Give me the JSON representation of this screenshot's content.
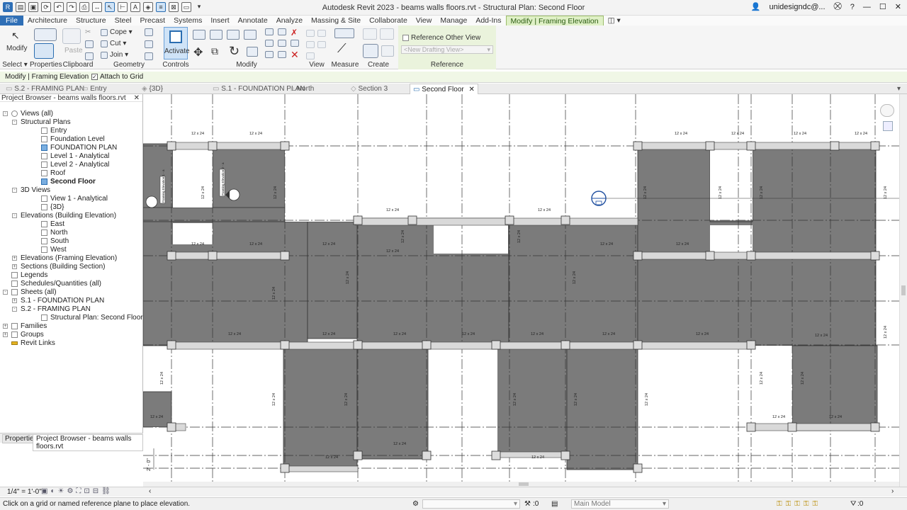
{
  "app": {
    "title": "Autodesk Revit 2023 - beams walls floors.rvt - Structural Plan: Second Floor",
    "user": "unidesigndc@..."
  },
  "menu": [
    "File",
    "Architecture",
    "Structure",
    "Steel",
    "Precast",
    "Systems",
    "Insert",
    "Annotate",
    "Analyze",
    "Massing & Site",
    "Collaborate",
    "View",
    "Manage",
    "Add-Ins",
    "Modify | Framing Elevation"
  ],
  "ribbon": {
    "modify_label": "Modify",
    "select_label": "Select ▾",
    "properties_label": "Properties",
    "paste_label": "Paste",
    "cope_label": "Cope ▾",
    "cut_label": "Cut ▾",
    "join_label": "Join ▾",
    "clipboard_label": "Clipboard",
    "geometry_label": "Geometry",
    "activate_label": "Activate",
    "controls_label": "Controls",
    "modify_panel_label": "Modify",
    "view_label": "View",
    "measure_label": "Measure",
    "create_label": "Create",
    "reference_label": "Reference",
    "reference_other_view": "Reference Other View",
    "drafting_view_placeholder": "<New Drafting View>"
  },
  "options_bar": {
    "context": "Modify | Framing Elevation",
    "attach_to_grid": "Attach to Grid"
  },
  "tabs": [
    "S.2 - FRAMING PLAN",
    "Entry",
    "{3D}",
    "S.1 - FOUNDATION PLAN",
    "North",
    "Section 3",
    "Second Floor"
  ],
  "browser": {
    "title": "Project Browser - beams walls floors.rvt",
    "nodes": [
      {
        "label": "Views (all)"
      },
      {
        "label": "Structural Plans"
      },
      {
        "label": "Entry"
      },
      {
        "label": "Foundation Level"
      },
      {
        "label": "FOUNDATION PLAN"
      },
      {
        "label": "Level 1 - Analytical"
      },
      {
        "label": "Level 2 - Analytical"
      },
      {
        "label": "Roof"
      },
      {
        "label": "Second Floor"
      },
      {
        "label": "3D Views"
      },
      {
        "label": "View 1 - Analytical"
      },
      {
        "label": "{3D}"
      },
      {
        "label": "Elevations (Building Elevation)"
      },
      {
        "label": "East"
      },
      {
        "label": "North"
      },
      {
        "label": "South"
      },
      {
        "label": "West"
      },
      {
        "label": "Elevations (Framing Elevation)"
      },
      {
        "label": "Sections (Building Section)"
      },
      {
        "label": "Legends"
      },
      {
        "label": "Schedules/Quantities (all)"
      },
      {
        "label": "Sheets (all)"
      },
      {
        "label": "S.1 - FOUNDATION PLAN"
      },
      {
        "label": "S.2 - FRAMING PLAN"
      },
      {
        "label": "Structural Plan: Second Floor"
      },
      {
        "label": "Families"
      },
      {
        "label": "Groups"
      },
      {
        "label": "Revit Links"
      }
    ],
    "bottom_tabs": [
      "Properties",
      "Project Browser - beams walls floors.rvt"
    ]
  },
  "plan": {
    "beam_tag": "12 x 24",
    "dim_text": "2' - 0\"",
    "elev_tag_1": "Framing Elevation 1 - a",
    "elev_tag_2": "Framing Elevation 2 - a"
  },
  "view_control": {
    "scale": "1/4\" = 1'-0\""
  },
  "status": {
    "message": "Click on a grid or named reference plane to place elevation.",
    "zero": ":0",
    "model": "Main Model",
    "filter_count": ":0"
  },
  "colors": {
    "accent": "#2f6fb6",
    "context_tab": "#dff0c6",
    "slab": "#7b7b7b"
  }
}
